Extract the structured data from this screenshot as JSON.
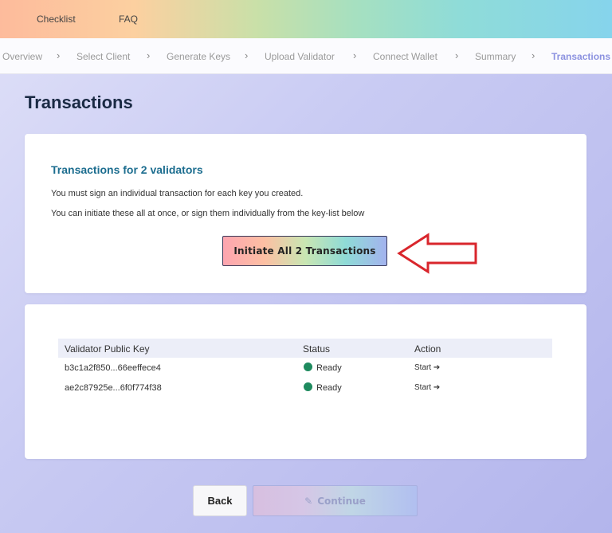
{
  "topnav": {
    "items": [
      "Checklist",
      "FAQ"
    ]
  },
  "breadcrumb": {
    "steps": [
      "Overview",
      "Select Client",
      "Generate Keys",
      "Upload Validator",
      "Connect Wallet",
      "Summary",
      "Transactions"
    ],
    "active": "Transactions"
  },
  "page": {
    "title": "Transactions"
  },
  "summary_card": {
    "heading": "Transactions for 2 validators",
    "line1": "You must sign an individual transaction for each key you created.",
    "line2": "You can initiate these all at once, or sign them individually from the key-list below",
    "button_label": "Initiate All 2 Transactions"
  },
  "table": {
    "headers": [
      "Validator Public Key",
      "Status",
      "Action"
    ],
    "rows": [
      {
        "key": "b3c1a2f850...66eeffece4",
        "status": "Ready",
        "action": "Start"
      },
      {
        "key": "ae2c87925e...6f0f774f38",
        "status": "Ready",
        "action": "Start"
      }
    ]
  },
  "footer": {
    "back_label": "Back",
    "continue_label": "Continue"
  },
  "colors": {
    "heading_accent": "#1c6d8f",
    "active_step": "#8c92e0",
    "status_ready": "#1e8a5e",
    "annotation_arrow": "#d9262c"
  }
}
